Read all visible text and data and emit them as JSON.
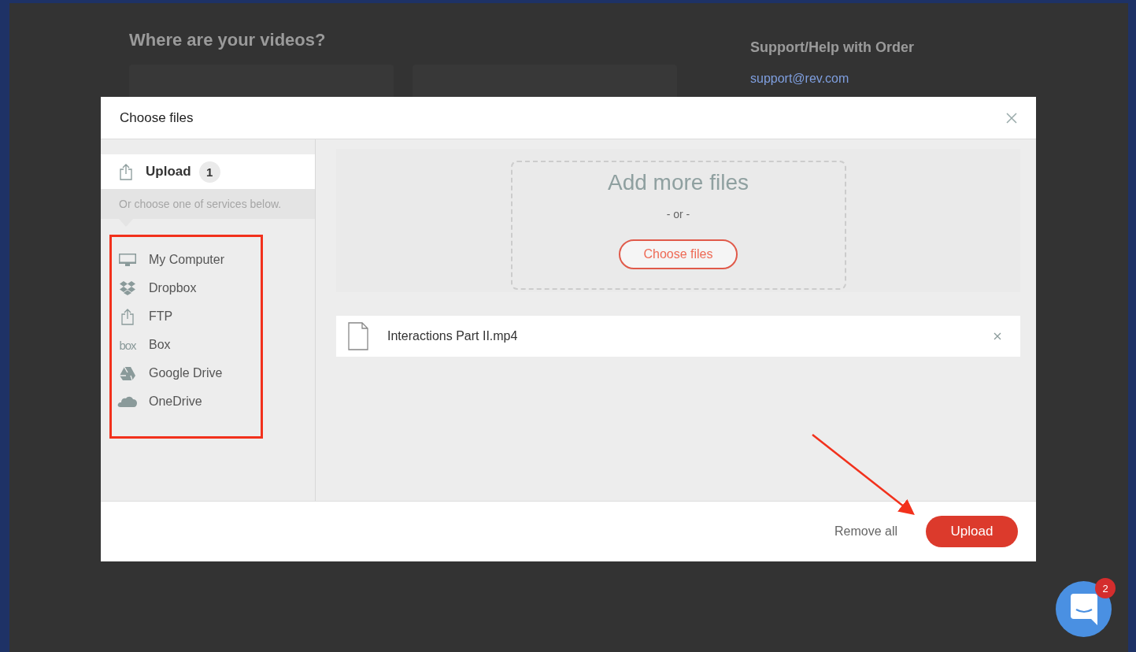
{
  "page": {
    "heading": "Where are your videos?",
    "support_title": "Support/Help with Order",
    "support_link": "support@rev.com"
  },
  "modal": {
    "title": "Choose files",
    "upload_tab": {
      "label": "Upload",
      "count": "1",
      "selected": true
    },
    "hint": "Or choose one of services below.",
    "services": [
      {
        "label": "My Computer",
        "kind": "monitor",
        "selected": false
      },
      {
        "label": "Dropbox",
        "kind": "dropbox",
        "selected": false
      },
      {
        "label": "FTP",
        "kind": "upload",
        "selected": false
      },
      {
        "label": "Box",
        "kind": "box",
        "logo": "box",
        "selected": false
      },
      {
        "label": "Google Drive",
        "kind": "drive",
        "selected": false
      },
      {
        "label": "OneDrive",
        "kind": "cloud",
        "selected": false
      }
    ],
    "dropzone": {
      "title": "Add more files",
      "separator": "- or -",
      "button": "Choose files"
    },
    "files": [
      {
        "name": "Interactions Part II.mp4"
      }
    ],
    "remove_all": "Remove all",
    "upload_button": "Upload"
  },
  "chat": {
    "badge": "2"
  }
}
